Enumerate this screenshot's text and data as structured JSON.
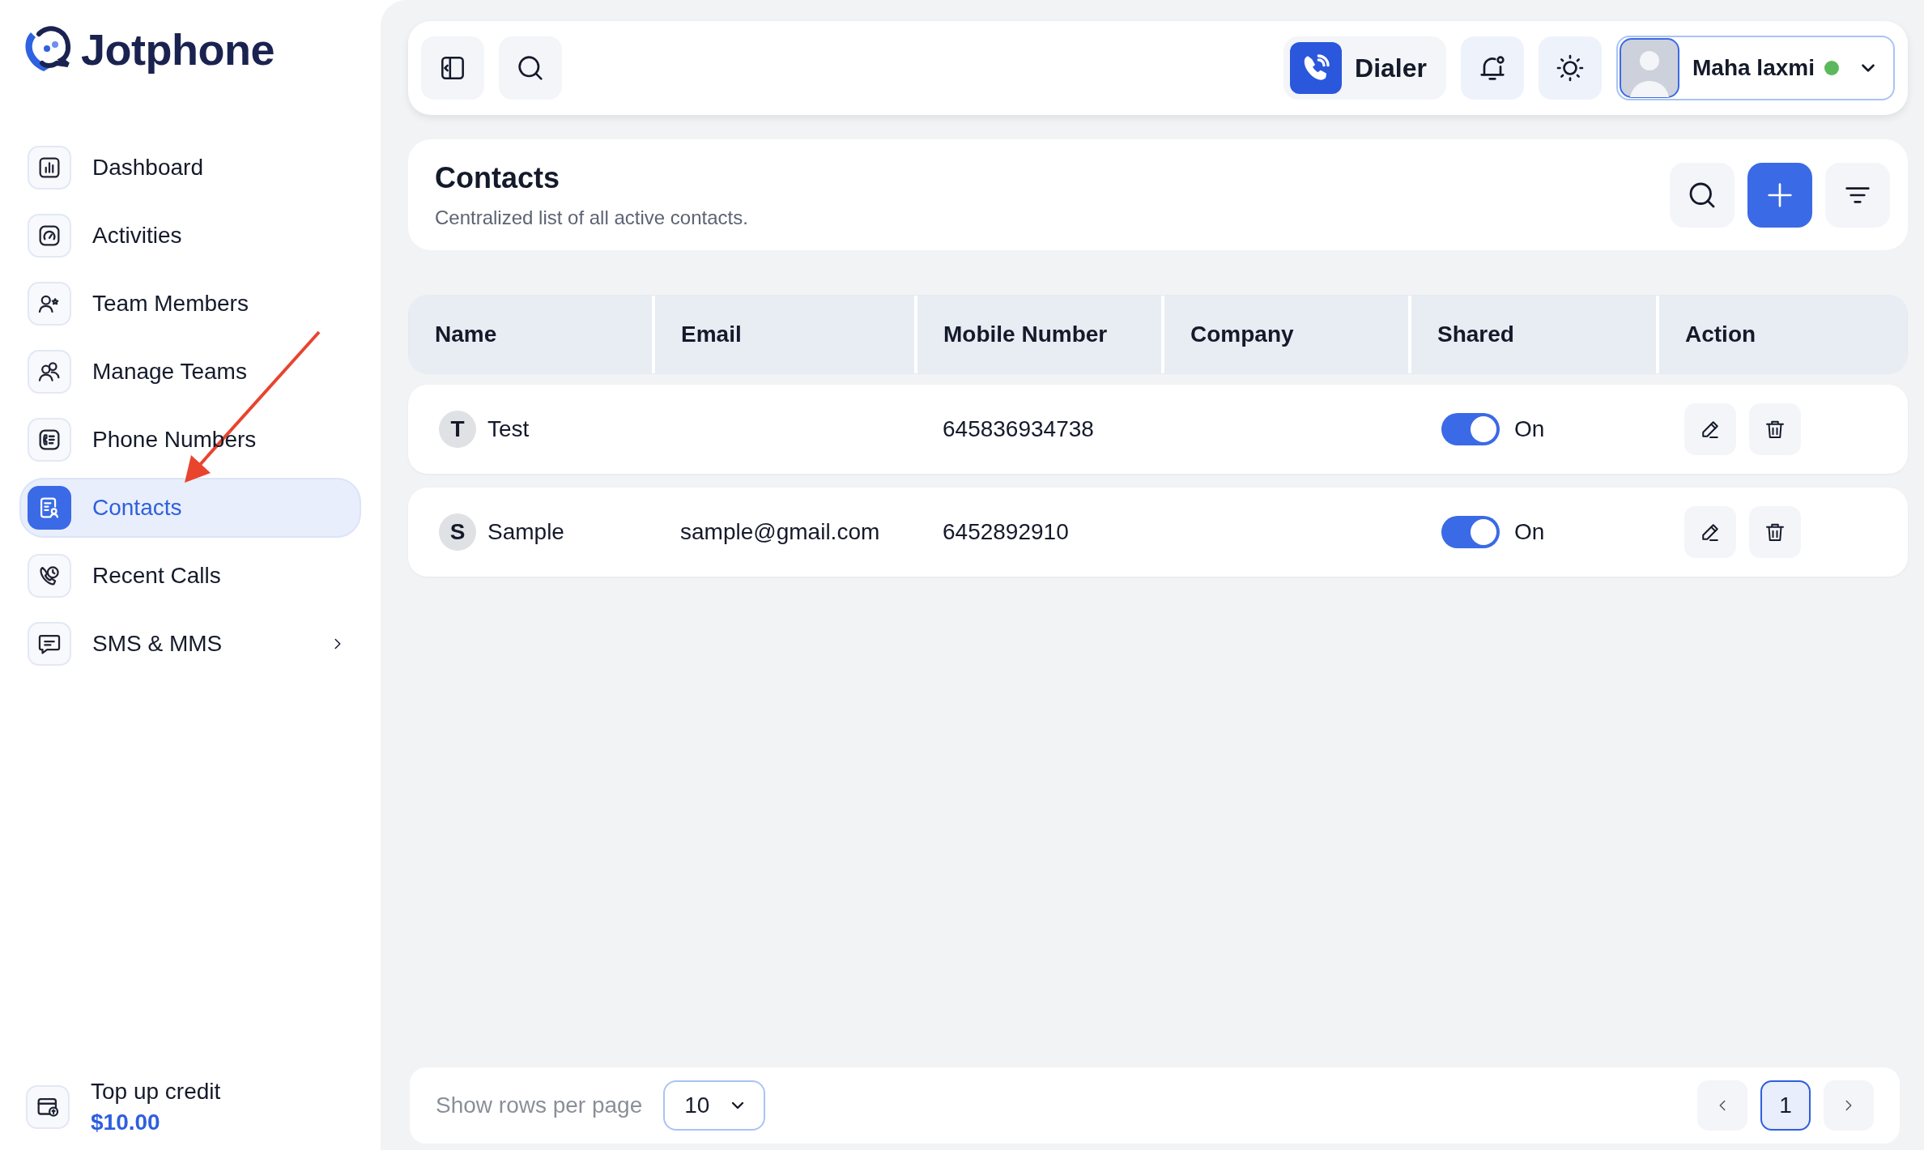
{
  "sidebar": {
    "brand": "Jotphone",
    "items": [
      {
        "kind": "dashboard",
        "label": "Dashboard",
        "selected": false,
        "submenu": false
      },
      {
        "kind": "activities",
        "label": "Activities",
        "selected": false,
        "submenu": false
      },
      {
        "kind": "team-members",
        "label": "Team Members",
        "selected": false,
        "submenu": false
      },
      {
        "kind": "manage-teams",
        "label": "Manage Teams",
        "selected": false,
        "submenu": false
      },
      {
        "kind": "phone-numbers",
        "label": "Phone Numbers",
        "selected": false,
        "submenu": false
      },
      {
        "kind": "contacts",
        "label": "Contacts",
        "selected": true,
        "submenu": false
      },
      {
        "kind": "recent-calls",
        "label": "Recent Calls",
        "selected": false,
        "submenu": false
      },
      {
        "kind": "sms",
        "label": "SMS & MMS",
        "selected": false,
        "submenu": true
      }
    ],
    "credit": {
      "label": "Top up credit",
      "amount": "$10.00"
    }
  },
  "topbar": {
    "dialer": "Dialer",
    "user": {
      "name": "Maha laxmi",
      "online": true
    }
  },
  "page": {
    "title": "Contacts",
    "subtitle": "Centralized list of all active contacts."
  },
  "table": {
    "columns": [
      "Name",
      "Email",
      "Mobile Number",
      "Company",
      "Shared",
      "Action"
    ],
    "rows": [
      {
        "initial": "T",
        "name": "Test",
        "mobile": "645836934738",
        "shared": {
          "on": true,
          "label": "On"
        }
      },
      {
        "initial": "S",
        "name": "Sample",
        "email": "sample@gmail.com",
        "mobile": "6452892910",
        "shared": {
          "on": true,
          "label": "On"
        }
      }
    ]
  },
  "pagination": {
    "rows_label": "Show rows per page",
    "rows_value": "10",
    "pages": [
      {
        "label": "1",
        "selected": true
      }
    ]
  }
}
